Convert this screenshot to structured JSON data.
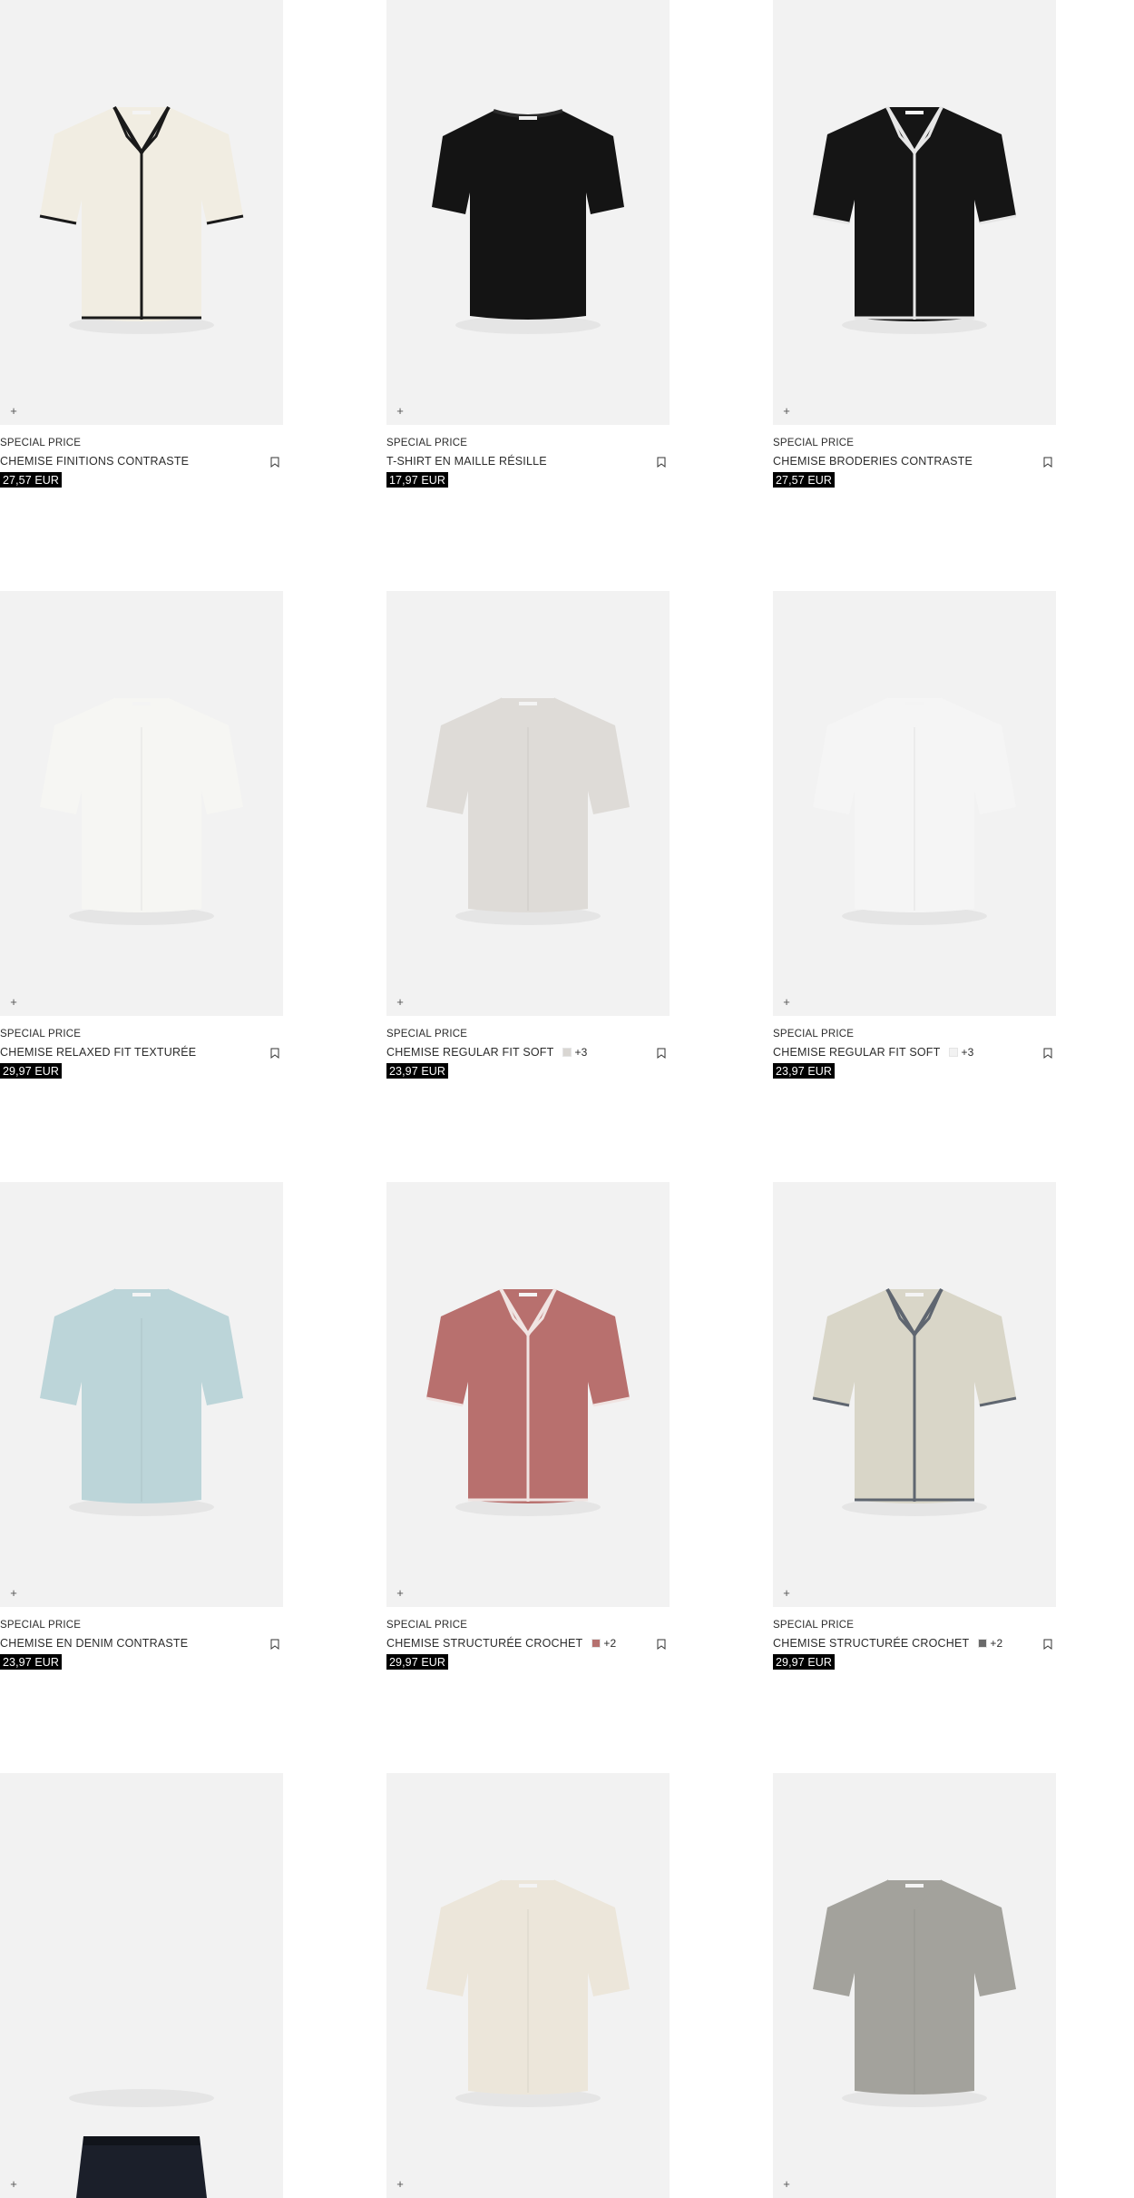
{
  "products": [
    {
      "tag": "SPECIAL PRICE",
      "name": "CHEMISE FINITIONS CONTRASTE",
      "price": "27,57 EUR",
      "colors": null,
      "shirt_color": "#f1ede2",
      "trim_color": "#1a1a1a",
      "style": "camp"
    },
    {
      "tag": "SPECIAL PRICE",
      "name": "T-SHIRT EN MAILLE RÉSILLE",
      "price": "17,97 EUR",
      "colors": null,
      "shirt_color": "#141414",
      "trim_color": "#141414",
      "style": "tee"
    },
    {
      "tag": "SPECIAL PRICE",
      "name": "CHEMISE BRODERIES CONTRASTE",
      "price": "27,57 EUR",
      "colors": null,
      "shirt_color": "#151515",
      "trim_color": "#e6e6e6",
      "style": "camp"
    },
    {
      "tag": "SPECIAL PRICE",
      "name": "CHEMISE RELAXED FIT TEXTURÉE",
      "price": "29,97 EUR",
      "colors": null,
      "shirt_color": "#f6f6f3",
      "trim_color": "#f6f6f3",
      "style": "collar"
    },
    {
      "tag": "SPECIAL PRICE",
      "name": "CHEMISE REGULAR FIT SOFT",
      "price": "23,97 EUR",
      "colors": {
        "swatch": "#d9d6d2",
        "more": "+3"
      },
      "shirt_color": "#dedbd7",
      "trim_color": "#dedbd7",
      "style": "collar"
    },
    {
      "tag": "SPECIAL PRICE",
      "name": "CHEMISE REGULAR FIT SOFT",
      "price": "23,97 EUR",
      "colors": {
        "swatch": "#f2f2f2",
        "more": "+3"
      },
      "shirt_color": "#f5f5f5",
      "trim_color": "#f5f5f5",
      "style": "collar"
    },
    {
      "tag": "SPECIAL PRICE",
      "name": "CHEMISE EN DENIM CONTRASTE",
      "price": "23,97 EUR",
      "colors": null,
      "shirt_color": "#bcd5d9",
      "trim_color": "#bcd5d9",
      "style": "collar"
    },
    {
      "tag": "SPECIAL PRICE",
      "name": "CHEMISE STRUCTURÉE CROCHET",
      "price": "29,97 EUR",
      "colors": {
        "swatch": "#b5716f",
        "more": "+2"
      },
      "shirt_color": "#b8706e",
      "trim_color": "#f0e4e2",
      "style": "camp"
    },
    {
      "tag": "SPECIAL PRICE",
      "name": "CHEMISE STRUCTURÉE CROCHET",
      "price": "29,97 EUR",
      "colors": {
        "swatch": "#6a6a6a",
        "more": "+2"
      },
      "shirt_color": "#d9d6c8",
      "trim_color": "#5f6670",
      "style": "camp"
    },
    {
      "tag": "",
      "name": "",
      "price": "",
      "colors": null,
      "shirt_color": "#1b1f2a",
      "trim_color": "#1b1f2a",
      "style": "pants"
    },
    {
      "tag": "",
      "name": "",
      "price": "",
      "colors": null,
      "shirt_color": "#ece6da",
      "trim_color": "#ece6da",
      "style": "collar"
    },
    {
      "tag": "",
      "name": "",
      "price": "",
      "colors": null,
      "shirt_color": "#a3a29c",
      "trim_color": "#a3a29c",
      "style": "collar"
    }
  ],
  "ui": {
    "plus_symbol": "+"
  }
}
